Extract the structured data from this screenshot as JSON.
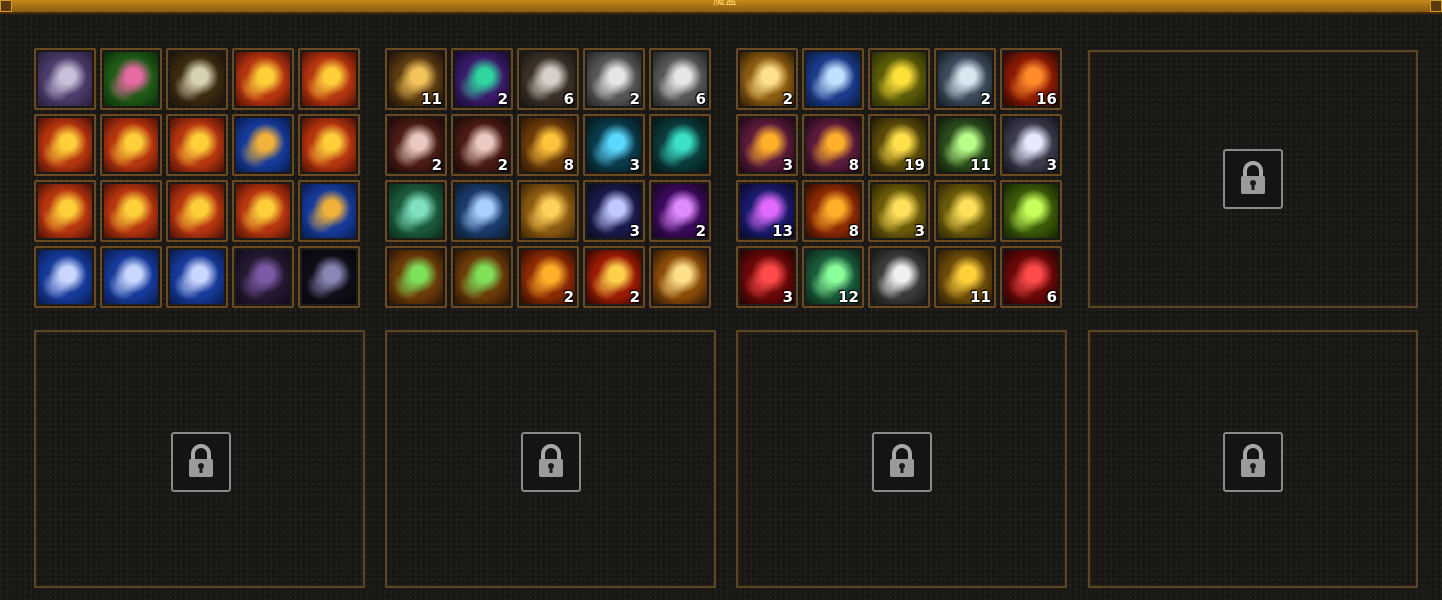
{
  "window": {
    "title": "魔盒"
  },
  "grids": [
    {
      "slots": [
        {
          "icon": "necklace-icon",
          "count": "",
          "colors": [
            "#4a3a6a",
            "#c7c0d8",
            "#2a1d3a"
          ]
        },
        {
          "icon": "pink-gem-pendant-icon",
          "count": "",
          "colors": [
            "#1f5a16",
            "#e76aa2",
            "#0b2a08"
          ]
        },
        {
          "icon": "jade-scroll-icon",
          "count": "",
          "colors": [
            "#3a2a10",
            "#d8d2b5",
            "#1a130a"
          ]
        },
        {
          "icon": "gold-ornament-icon",
          "count": "",
          "colors": [
            "#b5350f",
            "#ffcf3a",
            "#4a0f05"
          ]
        },
        {
          "icon": "gold-ornament-icon",
          "count": "",
          "colors": [
            "#b5350f",
            "#ffcf3a",
            "#4a0f05"
          ]
        },
        {
          "icon": "gold-ornament-icon",
          "count": "",
          "colors": [
            "#b5350f",
            "#ffcf3a",
            "#4a0f05"
          ]
        },
        {
          "icon": "gold-ornament-icon",
          "count": "",
          "colors": [
            "#b5350f",
            "#ffcf3a",
            "#4a0f05"
          ]
        },
        {
          "icon": "gold-ornament-icon",
          "count": "",
          "colors": [
            "#b5350f",
            "#ffcf3a",
            "#4a0f05"
          ]
        },
        {
          "icon": "blue-ornament-icon",
          "count": "",
          "colors": [
            "#163a9a",
            "#f2b23a",
            "#081a4a"
          ]
        },
        {
          "icon": "gold-ornament-icon",
          "count": "",
          "colors": [
            "#b5350f",
            "#ffcf3a",
            "#4a0f05"
          ]
        },
        {
          "icon": "gold-ornament-icon",
          "count": "",
          "colors": [
            "#b5350f",
            "#ffcf3a",
            "#4a0f05"
          ]
        },
        {
          "icon": "gold-ornament-icon",
          "count": "",
          "colors": [
            "#b5350f",
            "#ffcf3a",
            "#4a0f05"
          ]
        },
        {
          "icon": "gold-ornament-icon",
          "count": "",
          "colors": [
            "#b5350f",
            "#ffcf3a",
            "#4a0f05"
          ]
        },
        {
          "icon": "gold-ornament-icon",
          "count": "",
          "colors": [
            "#b5350f",
            "#ffcf3a",
            "#4a0f05"
          ]
        },
        {
          "icon": "blue-ornament-icon",
          "count": "",
          "colors": [
            "#163a9a",
            "#f2b23a",
            "#081a4a"
          ]
        },
        {
          "icon": "blue-ornament-icon",
          "count": "",
          "colors": [
            "#163a9a",
            "#c9d6ff",
            "#081a4a"
          ]
        },
        {
          "icon": "blue-ornament-icon",
          "count": "",
          "colors": [
            "#163a9a",
            "#c9d6ff",
            "#081a4a"
          ]
        },
        {
          "icon": "blue-ornament-icon",
          "count": "",
          "colors": [
            "#163a9a",
            "#c9d6ff",
            "#081a4a"
          ]
        },
        {
          "icon": "purple-chain-icon",
          "count": "",
          "colors": [
            "#241830",
            "#7d5aa8",
            "#100a18"
          ]
        },
        {
          "icon": "dark-orb-icon",
          "count": "",
          "colors": [
            "#0e0e18",
            "#8a86b5",
            "#05050a"
          ]
        }
      ]
    },
    {
      "slots": [
        {
          "icon": "gold-pile-icon",
          "count": "11",
          "colors": [
            "#5a3a10",
            "#f2c35a",
            "#1a1006"
          ]
        },
        {
          "icon": "emerald-gem-icon",
          "count": "2",
          "colors": [
            "#3a1a6a",
            "#2fd6a0",
            "#150a2a"
          ]
        },
        {
          "icon": "ore-chunks-icon",
          "count": "6",
          "colors": [
            "#3a3028",
            "#d8d0c8",
            "#1a1410"
          ]
        },
        {
          "icon": "silver-ore-icon",
          "count": "2",
          "colors": [
            "#555",
            "#e6e6e6",
            "#222"
          ]
        },
        {
          "icon": "silver-ore-icon",
          "count": "6",
          "colors": [
            "#555",
            "#e6e6e6",
            "#222"
          ]
        },
        {
          "icon": "red-crystal-shards-icon",
          "count": "2",
          "colors": [
            "#4a1a14",
            "#e8c8c0",
            "#1a0806"
          ]
        },
        {
          "icon": "red-crystal-shards-icon",
          "count": "2",
          "colors": [
            "#4a1a14",
            "#e8c8c0",
            "#1a0806"
          ]
        },
        {
          "icon": "golden-helmet-icon",
          "count": "8",
          "colors": [
            "#6a3a08",
            "#ffc23a",
            "#2a1504"
          ]
        },
        {
          "icon": "crystal-ball-icon",
          "count": "3",
          "colors": [
            "#0a3a4a",
            "#5ad8ff",
            "#04141a"
          ]
        },
        {
          "icon": "teal-rune-disc-icon",
          "count": "",
          "colors": [
            "#0a3a3a",
            "#3ae0c8",
            "#041414"
          ]
        },
        {
          "icon": "green-chest-icon",
          "count": "",
          "colors": [
            "#1a5a3a",
            "#7fe0c0",
            "#0a2a1a"
          ]
        },
        {
          "icon": "blue-chest-icon",
          "count": "",
          "colors": [
            "#1a3a6a",
            "#a8d0ff",
            "#0a1a2a"
          ]
        },
        {
          "icon": "gold-treasure-chest-icon",
          "count": "",
          "colors": [
            "#8a5a10",
            "#ffd05a",
            "#3a2204"
          ]
        },
        {
          "icon": "spirit-deer-icon",
          "count": "3",
          "colors": [
            "#1a1a4a",
            "#c0c8ff",
            "#0a0a1a"
          ]
        },
        {
          "icon": "purple-crystal-icon",
          "count": "2",
          "colors": [
            "#3a0a5a",
            "#e08aff",
            "#16041e"
          ]
        },
        {
          "icon": "gift-box-icon",
          "count": "",
          "colors": [
            "#6a3a08",
            "#7fe05a",
            "#2a1504"
          ]
        },
        {
          "icon": "gift-box-icon",
          "count": "",
          "colors": [
            "#6a3a08",
            "#7fe05a",
            "#2a1504"
          ]
        },
        {
          "icon": "golden-feather-icon",
          "count": "2",
          "colors": [
            "#8a2a04",
            "#ffb02a",
            "#2a0a02"
          ]
        },
        {
          "icon": "fire-scroll-icon",
          "count": "2",
          "colors": [
            "#9a1a04",
            "#ffd04a",
            "#2a0602"
          ]
        },
        {
          "icon": "card-bundle-icon",
          "count": "",
          "colors": [
            "#8a4a08",
            "#ffe08a",
            "#2a1604"
          ]
        }
      ]
    },
    {
      "slots": [
        {
          "icon": "golden-ticket-icon",
          "count": "2",
          "colors": [
            "#8a5a10",
            "#ffe08a",
            "#2a1a04"
          ]
        },
        {
          "icon": "palace-scroll-icon",
          "count": "",
          "colors": [
            "#1a3a8a",
            "#c0e0ff",
            "#0a1a3a"
          ]
        },
        {
          "icon": "gold-book-icon",
          "count": "",
          "colors": [
            "#5a5a08",
            "#ffe03a",
            "#2a2a04"
          ]
        },
        {
          "icon": "silver-token-icon",
          "count": "2",
          "colors": [
            "#3a4a5a",
            "#d8e8f0",
            "#141a20"
          ]
        },
        {
          "icon": "fire-dragon-icon",
          "count": "16",
          "colors": [
            "#8a1a04",
            "#ff8a2a",
            "#2a0602"
          ]
        },
        {
          "icon": "bronze-dragon-icon",
          "count": "3",
          "colors": [
            "#5a1a3a",
            "#ffb02a",
            "#1e0614"
          ]
        },
        {
          "icon": "bronze-dragon-icon",
          "count": "8",
          "colors": [
            "#5a1a3a",
            "#ffb02a",
            "#1e0614"
          ]
        },
        {
          "icon": "gold-coins-icon",
          "count": "19",
          "colors": [
            "#5a4a08",
            "#ffe04a",
            "#1e1804"
          ]
        },
        {
          "icon": "jade-clover-icon",
          "count": "11",
          "colors": [
            "#2a4a1a",
            "#b8ff8a",
            "#0e1a08"
          ]
        },
        {
          "icon": "pearl-beads-icon",
          "count": "3",
          "colors": [
            "#3a3a4a",
            "#e8e8ff",
            "#141420"
          ]
        },
        {
          "icon": "molecule-orb-icon",
          "count": "13",
          "colors": [
            "#1a1a6a",
            "#e06aff",
            "#080828"
          ]
        },
        {
          "icon": "fire-orb-icon",
          "count": "8",
          "colors": [
            "#8a2a04",
            "#ffb02a",
            "#2a0a02"
          ]
        },
        {
          "icon": "golden-egg-icon",
          "count": "3",
          "colors": [
            "#6a5a08",
            "#ffe05a",
            "#2a2204"
          ]
        },
        {
          "icon": "golden-egg-icon",
          "count": "",
          "colors": [
            "#6a5a08",
            "#ffe05a",
            "#2a2204"
          ]
        },
        {
          "icon": "green-egg-icon",
          "count": "",
          "colors": [
            "#3a5a08",
            "#c8ff5a",
            "#142204"
          ]
        },
        {
          "icon": "red-bead-icon",
          "count": "3",
          "colors": [
            "#6a0808",
            "#ff4a4a",
            "#200202"
          ]
        },
        {
          "icon": "jade-pendant-icon",
          "count": "12",
          "colors": [
            "#1a5a3a",
            "#8aff9a",
            "#082014"
          ]
        },
        {
          "icon": "silver-ore-icon",
          "count": "",
          "colors": [
            "#3a3a3a",
            "#f0f0f0",
            "#141414"
          ]
        },
        {
          "icon": "golden-horn-icon",
          "count": "11",
          "colors": [
            "#6a4a08",
            "#ffd03a",
            "#2a1a04"
          ]
        },
        {
          "icon": "red-bead-icon",
          "count": "6",
          "colors": [
            "#6a0808",
            "#ff4a4a",
            "#200202"
          ]
        }
      ]
    }
  ],
  "locked_panels": [
    {
      "icon": "lock-icon"
    },
    {
      "icon": "lock-icon"
    },
    {
      "icon": "lock-icon"
    },
    {
      "icon": "lock-icon"
    },
    {
      "icon": "lock-icon"
    }
  ]
}
